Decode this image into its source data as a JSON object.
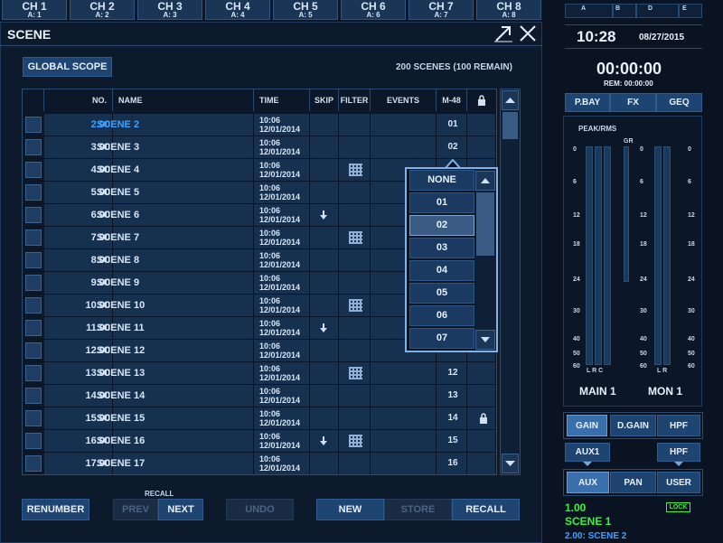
{
  "channels": [
    {
      "name": "CH 1",
      "assign": "A: 1"
    },
    {
      "name": "CH 2",
      "assign": "A: 2"
    },
    {
      "name": "CH 3",
      "assign": "A: 3"
    },
    {
      "name": "CH 4",
      "assign": "A: 4"
    },
    {
      "name": "CH 5",
      "assign": "A: 5"
    },
    {
      "name": "CH 6",
      "assign": "A: 6"
    },
    {
      "name": "CH 7",
      "assign": "A: 7"
    },
    {
      "name": "CH 8",
      "assign": "A: 8"
    }
  ],
  "window": {
    "title": "SCENE"
  },
  "global_scope_label": "GLOBAL SCOPE",
  "scene_count": "200 SCENES (100 REMAIN)",
  "table": {
    "headers": {
      "no": "NO.",
      "name": "NAME",
      "time": "TIME",
      "skip": "SKIP",
      "filter": "FILTER",
      "events": "EVENTS",
      "m48": "M-48"
    },
    "rows": [
      {
        "no": "2.00",
        "name": "SCENE 2",
        "time": "10:06",
        "date": "12/01/2014",
        "m48": "01",
        "selected": true
      },
      {
        "no": "3.00",
        "name": "SCENE 3",
        "time": "10:06",
        "date": "12/01/2014",
        "m48": "02"
      },
      {
        "no": "4.00",
        "name": "SCENE 4",
        "time": "10:06",
        "date": "12/01/2014",
        "m48": "",
        "filter": true
      },
      {
        "no": "5.00",
        "name": "SCENE 5",
        "time": "10:06",
        "date": "12/01/2014",
        "m48": ""
      },
      {
        "no": "6.00",
        "name": "SCENE 6",
        "time": "10:06",
        "date": "12/01/2014",
        "m48": "",
        "skip": true
      },
      {
        "no": "7.00",
        "name": "SCENE 7",
        "time": "10:06",
        "date": "12/01/2014",
        "m48": "",
        "filter": true
      },
      {
        "no": "8.00",
        "name": "SCENE 8",
        "time": "10:06",
        "date": "12/01/2014",
        "m48": ""
      },
      {
        "no": "9.00",
        "name": "SCENE 9",
        "time": "10:06",
        "date": "12/01/2014",
        "m48": ""
      },
      {
        "no": "10.00",
        "name": "SCENE 10",
        "time": "10:06",
        "date": "12/01/2014",
        "m48": "",
        "filter": true
      },
      {
        "no": "11.00",
        "name": "SCENE 11",
        "time": "10:06",
        "date": "12/01/2014",
        "m48": "",
        "skip": true
      },
      {
        "no": "12.00",
        "name": "SCENE 12",
        "time": "10:06",
        "date": "12/01/2014",
        "m48": ""
      },
      {
        "no": "13.00",
        "name": "SCENE 13",
        "time": "10:06",
        "date": "12/01/2014",
        "m48": "12",
        "filter": true
      },
      {
        "no": "14.00",
        "name": "SCENE 14",
        "time": "10:06",
        "date": "12/01/2014",
        "m48": "13"
      },
      {
        "no": "15.00",
        "name": "SCENE 15",
        "time": "10:06",
        "date": "12/01/2014",
        "m48": "14",
        "locked": true
      },
      {
        "no": "16.00",
        "name": "SCENE 16",
        "time": "10:06",
        "date": "12/01/2014",
        "m48": "15",
        "skip": true,
        "filter": true
      },
      {
        "no": "17.00",
        "name": "SCENE 17",
        "time": "10:06",
        "date": "12/01/2014",
        "m48": "16"
      }
    ]
  },
  "dropdown": {
    "options": [
      "NONE",
      "01",
      "02",
      "03",
      "04",
      "05",
      "06",
      "07"
    ],
    "selected": "02"
  },
  "bottom": {
    "renumber": "RENUMBER",
    "recall_group": "RECALL",
    "prev": "PREV",
    "next": "NEXT",
    "undo": "UNDO",
    "new": "NEW",
    "store": "STORE",
    "recall": "RECALL"
  },
  "right": {
    "top_labels": [
      "A",
      "B",
      "D",
      "E"
    ],
    "time": "10:28",
    "date": "08/27/2015",
    "timer": "00:00:00",
    "rem": "REM: 00:00:00",
    "tabs": [
      "P.BAY",
      "FX",
      "GEQ"
    ],
    "meter_title": "PEAK/RMS",
    "gr": "GR",
    "scale": [
      "0",
      "6",
      "12",
      "18",
      "24",
      "30",
      "40",
      "50",
      "60"
    ],
    "lrc": "L R C",
    "lr": "L R",
    "main": "MAIN 1",
    "mon": "MON 1",
    "gain_row": [
      "GAIN",
      "D.GAIN",
      "HPF"
    ],
    "aux1": "AUX1",
    "hpf2": "HPF",
    "mode_row": [
      "AUX",
      "PAN",
      "USER"
    ],
    "lock": "LOCK",
    "current_no": "1.00",
    "current_name": "SCENE 1",
    "next_scene": "2.00: SCENE 2"
  },
  "colors": {
    "accent": "#3fa0ff",
    "green": "#3cf23c",
    "button": "#1e4472"
  }
}
